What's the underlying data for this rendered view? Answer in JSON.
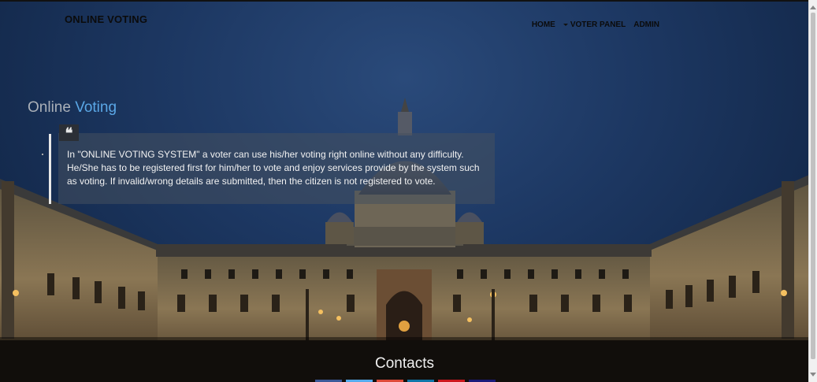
{
  "header": {
    "brand": "ONLINE VOTING",
    "nav": [
      {
        "label": "HOME"
      },
      {
        "label": "VOTER PANEL",
        "has_dropdown": true
      },
      {
        "label": "ADMIN"
      }
    ]
  },
  "hero": {
    "title_part1": "Online ",
    "title_part2": "Voting",
    "quote_icon": "quote-icon",
    "quote_text": "In \"ONLINE VOTING SYSTEM\" a voter can use his/her voting right online without any difficulty. He/She has to be registered first for him/her to vote and enjoy services provide by the system such as voting. If invalid/wrong details are submitted, then the citizen is not registered to vote."
  },
  "footer": {
    "contacts_label": "Contacts",
    "social_colors": [
      "#3b5998",
      "#55acee",
      "#dd4b39",
      "#0e76a8",
      "#cc181e",
      "#1a1a7a"
    ]
  },
  "colors": {
    "accent": "#5aa7e6",
    "quote_bg": "#46505f"
  }
}
